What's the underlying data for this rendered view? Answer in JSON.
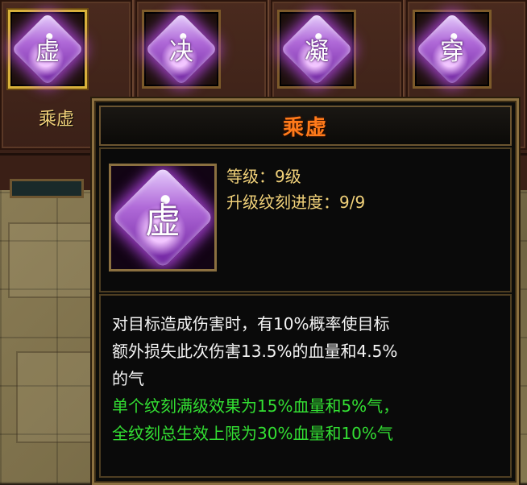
{
  "skills": [
    {
      "glyph": "虚",
      "name": "乘虚",
      "selected": true
    },
    {
      "glyph": "决",
      "name": "",
      "selected": false
    },
    {
      "glyph": "凝",
      "name": "",
      "selected": false
    },
    {
      "glyph": "穿",
      "name": "",
      "selected": false
    }
  ],
  "tooltip": {
    "title": "乘虚",
    "icon_glyph": "虚",
    "level_label": "等级：",
    "level_value": "9级",
    "progress_label": "升级纹刻进度：",
    "progress_value": "9/9",
    "description": [
      "对目标造成伤害时，有10%概率使目标",
      "额外损失此次伤害13.5%的血量和4.5%",
      "的气"
    ],
    "effects": [
      "单个纹刻满级效果为15%血量和5%气，",
      "全纹刻总生效上限为30%血量和10%气"
    ]
  },
  "colors": {
    "title": "#ff7a1a",
    "stat_text": "#f2d27a",
    "desc_text": "#f4f4f4",
    "effect_text": "#33e033",
    "gem_glow": "#c850ff"
  }
}
